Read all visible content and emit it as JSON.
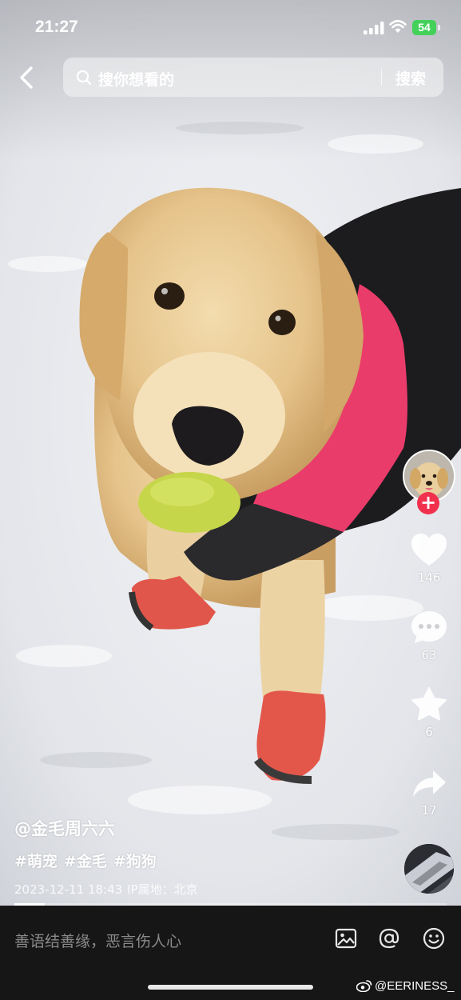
{
  "status": {
    "time": "21:27",
    "battery": "54"
  },
  "search": {
    "placeholder": "搜你想看的",
    "button_label": "搜索"
  },
  "actions": {
    "likes": "146",
    "comments": "63",
    "favorites": "6",
    "shares": "17"
  },
  "post": {
    "author": "@金毛周六六",
    "hashtags": [
      "#萌宠",
      "#金毛",
      "#狗狗"
    ],
    "date": "2023-12-11 18:43",
    "location": "IP属地：北京",
    "progress": 0.07
  },
  "comment_bar": {
    "placeholder": "善语结善缘，恶言伤人心"
  },
  "watermark": "@EERINESS_",
  "colors": {
    "like_red": "#f1304d",
    "battery_green": "#43d15a",
    "bar_bg": "#161616"
  }
}
